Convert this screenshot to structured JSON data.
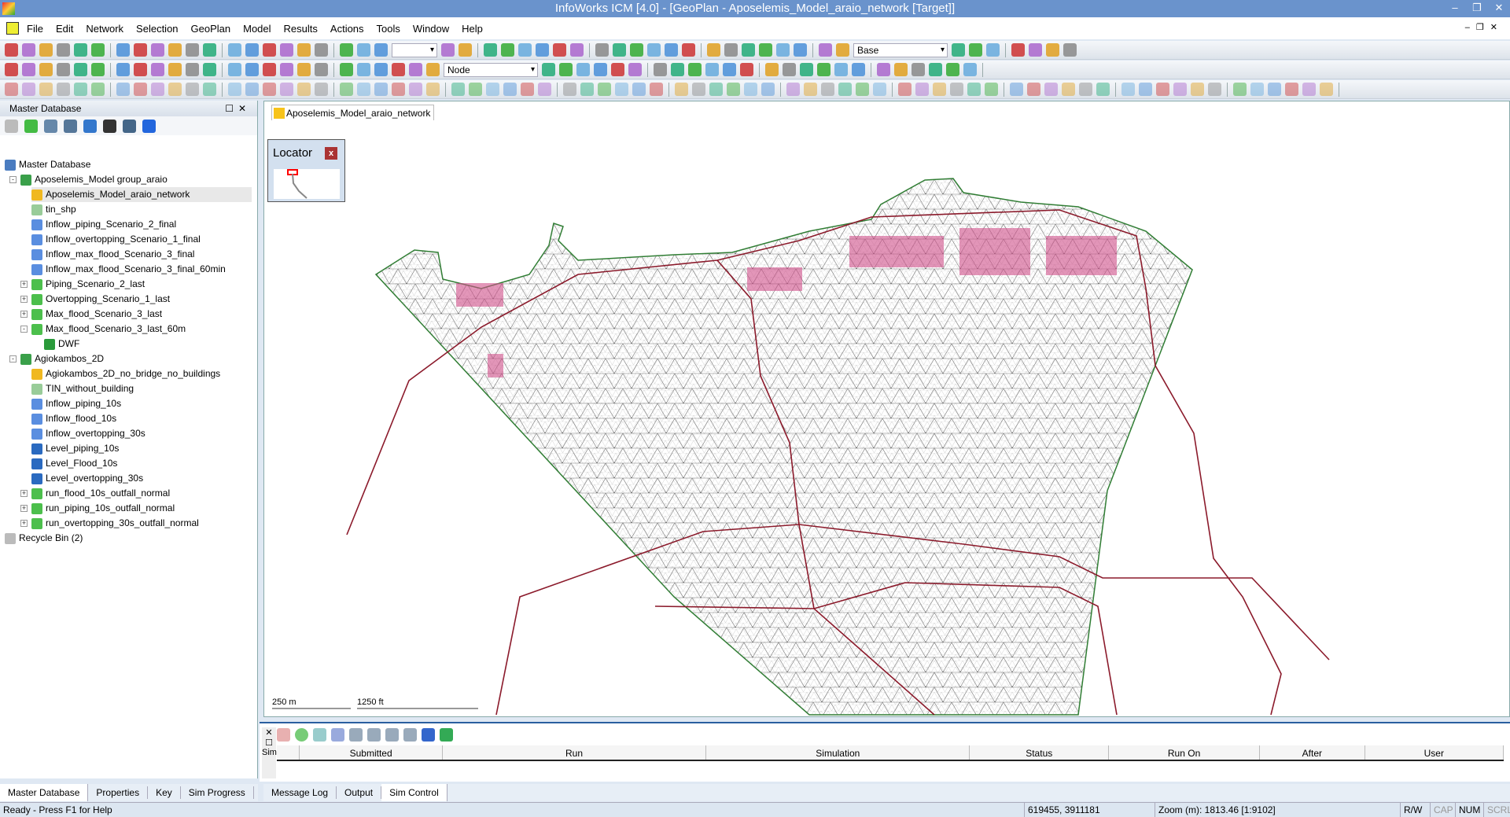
{
  "window": {
    "title": "InfoWorks ICM [4.0] - [GeoPlan - Aposelemis_Model_araio_network [Target]]"
  },
  "menu": [
    "File",
    "Edit",
    "Network",
    "Selection",
    "GeoPlan",
    "Model",
    "Results",
    "Actions",
    "Tools",
    "Window",
    "Help"
  ],
  "toolbar": {
    "node_combo": "Node",
    "base_combo": "Base",
    "blank_combo": ""
  },
  "left_panel": {
    "title": "Master Database",
    "tree": [
      {
        "label": "Master Database",
        "level": 0,
        "icon": "database-icon",
        "color": "#4a7cc0"
      },
      {
        "label": "Aposelemis_Model group_araio",
        "level": 1,
        "icon": "model-group-icon",
        "color": "#3aa04a",
        "exp": "-"
      },
      {
        "label": "Aposelemis_Model_araio_network",
        "level": 2,
        "icon": "network-icon",
        "color": "#f0b820",
        "sel": true
      },
      {
        "label": "tin_shp",
        "level": 2,
        "icon": "tin-icon",
        "color": "#9c9"
      },
      {
        "label": "Inflow_piping_Scenario_2_final",
        "level": 2,
        "icon": "inflow-icon",
        "color": "#5a8ee0"
      },
      {
        "label": "Inflow_overtopping_Scenario_1_final",
        "level": 2,
        "icon": "inflow-icon",
        "color": "#5a8ee0"
      },
      {
        "label": "Inflow_max_flood_Scenario_3_final",
        "level": 2,
        "icon": "inflow-icon",
        "color": "#5a8ee0"
      },
      {
        "label": "Inflow_max_flood_Scenario_3_final_60min",
        "level": 2,
        "icon": "inflow-icon",
        "color": "#5a8ee0"
      },
      {
        "label": "Piping_Scenario_2_last",
        "level": 2,
        "icon": "run-icon",
        "color": "#4cbf4c",
        "exp": "+"
      },
      {
        "label": "Overtopping_Scenario_1_last",
        "level": 2,
        "icon": "run-icon",
        "color": "#4cbf4c",
        "exp": "+"
      },
      {
        "label": "Max_flood_Scenario_3_last",
        "level": 2,
        "icon": "run-icon",
        "color": "#4cbf4c",
        "exp": "+"
      },
      {
        "label": "Max_flood_Scenario_3_last_60m",
        "level": 2,
        "icon": "run-icon",
        "color": "#4cbf4c",
        "exp": "-"
      },
      {
        "label": "DWF",
        "level": 3,
        "icon": "sim-icon",
        "color": "#2a9a3a"
      },
      {
        "label": "Agiokambos_2D",
        "level": 1,
        "icon": "model-group-icon",
        "color": "#3aa04a",
        "exp": "-"
      },
      {
        "label": "Agiokambos_2D_no_bridge_no_buildings",
        "level": 2,
        "icon": "network-error-icon",
        "color": "#f0b820"
      },
      {
        "label": "TIN_without_building",
        "level": 2,
        "icon": "tin-icon",
        "color": "#9c9"
      },
      {
        "label": "Inflow_piping_10s",
        "level": 2,
        "icon": "inflow-icon",
        "color": "#5a8ee0"
      },
      {
        "label": "Inflow_flood_10s",
        "level": 2,
        "icon": "inflow-icon",
        "color": "#5a8ee0"
      },
      {
        "label": "Inflow_overtopping_30s",
        "level": 2,
        "icon": "inflow-icon",
        "color": "#5a8ee0"
      },
      {
        "label": "Level_piping_10s",
        "level": 2,
        "icon": "level-icon",
        "color": "#2a6ac0"
      },
      {
        "label": "Level_Flood_10s",
        "level": 2,
        "icon": "level-icon",
        "color": "#2a6ac0"
      },
      {
        "label": "Level_overtopping_30s",
        "level": 2,
        "icon": "level-icon",
        "color": "#2a6ac0"
      },
      {
        "label": "run_flood_10s_outfall_normal",
        "level": 2,
        "icon": "run-icon",
        "color": "#4cbf4c",
        "exp": "+"
      },
      {
        "label": "run_piping_10s_outfall_normal",
        "level": 2,
        "icon": "run-icon",
        "color": "#4cbf4c",
        "exp": "+"
      },
      {
        "label": "run_overtopping_30s_outfall_normal",
        "level": 2,
        "icon": "run-icon",
        "color": "#4cbf4c",
        "exp": "+"
      },
      {
        "label": "Recycle Bin (2)",
        "level": 0,
        "icon": "recycle-bin-icon",
        "color": "#bbb"
      }
    ]
  },
  "map": {
    "tab": "Aposelemis_Model_araio_network",
    "locator": "Locator",
    "scale_m": "250 m",
    "scale_ft": "1250 ft",
    "colors": {
      "mesh_boundary": "#2e7d32",
      "river": "#8b1a2b",
      "mesh": "#555555",
      "building": "#d0508a"
    }
  },
  "sim_control": {
    "columns": [
      "",
      "Submitted",
      "Run",
      "Simulation",
      "Status",
      "Run On",
      "After",
      "User"
    ],
    "side_label": "Sim"
  },
  "left_tabs": [
    "Master Database",
    "Properties",
    "Key",
    "Sim Progress"
  ],
  "bottom_tabs": [
    "Message Log",
    "Output",
    "Sim Control"
  ],
  "status": {
    "help": "Ready - Press F1 for Help",
    "coords": "619455, 3911181",
    "zoom": "Zoom (m): 1813.46 [1:9102]",
    "rw": "R/W",
    "cap": "CAP",
    "num": "NUM",
    "scrl": "SCRL"
  }
}
